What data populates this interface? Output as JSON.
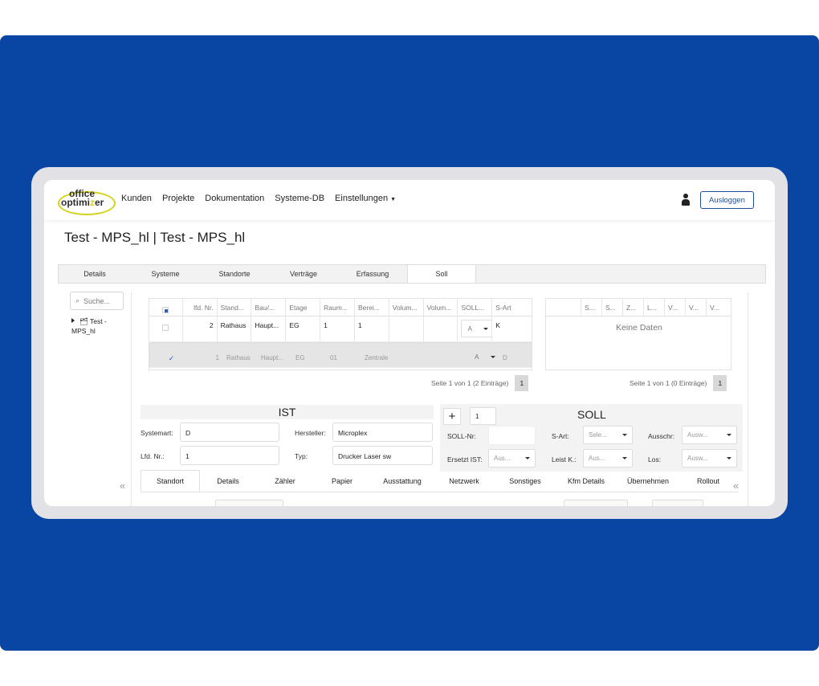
{
  "nav": {
    "logo_line1": "office",
    "logo_line2": "optimi",
    "logo_line3": "er",
    "items": [
      "Kunden",
      "Projekte",
      "Dokumentation",
      "Systeme-DB",
      "Einstellungen"
    ],
    "logout_label": "Ausloggen"
  },
  "page": {
    "title": "Test - MPS_hl | Test - MPS_hl"
  },
  "tabs1": [
    "Details",
    "Systeme",
    "Standorte",
    "Verträge",
    "Erfassung",
    "Soll"
  ],
  "sidebar": {
    "search_placeholder": "Suche...",
    "tree_item": "Test -",
    "tree_item2": "MPS_hl"
  },
  "grid": {
    "headers": [
      "lfd. Nr.",
      "Stand...",
      "Bau/...",
      "Etage",
      "Raum...",
      "Berei...",
      "Volum...",
      "Volum...",
      "SOLL...",
      "S-Art"
    ],
    "rows": [
      {
        "nr": "2",
        "stand": "Rathaus",
        "bau": "Haupt...",
        "etage": "EG",
        "raum": "1",
        "berei": "1",
        "dd": "A",
        "sart": "K"
      },
      {
        "nr": "1",
        "stand": "Rathaus",
        "bau": "Haupt...",
        "etage": "EG",
        "raum": "01",
        "berei": "Zentrale",
        "dd": "A",
        "sart": "D"
      }
    ],
    "pager_text": "Seite 1 von 1 (2 Einträge)",
    "page": "1"
  },
  "grid2": {
    "headers": [
      "S...",
      "S...",
      "Z...",
      "L...",
      "V...",
      "V...",
      "V..."
    ],
    "empty": "Keine Daten",
    "pager_text": "Seite 1 von 1 (0 Einträge)",
    "page": "1"
  },
  "ist": {
    "title": "IST",
    "systemart_label": "Systemart:",
    "systemart_value": "D",
    "hersteller_label": "Hersteller:",
    "hersteller_value": "Microplex",
    "lfd_label": "Lfd. Nr.:",
    "lfd_value": "1",
    "typ_label": "Typ:",
    "typ_value": "Drucker Laser sw"
  },
  "soll": {
    "title": "SOLL",
    "plus": "+",
    "number": "1",
    "sollnr_label": "SOLL-Nr:",
    "sart_label": "S-Art:",
    "sart_value": "Sele...",
    "ausschr_label": "Ausschr:",
    "ausschr_value": "Ausw...",
    "ersetzt_label": "Ersetzt IST:",
    "ersetzt_value": "Aus...",
    "leistk_label": "Leist K.:",
    "leistk_value": "Aus...",
    "los_label": "Los:",
    "los_value": "Ausw..."
  },
  "tabs2": [
    "Standort",
    "Details",
    "Zähler",
    "Papier",
    "Ausstattung",
    "Netzwerk",
    "Sonstiges",
    "Kfm Details",
    "Übernehmen",
    "Rollout"
  ],
  "colors": {
    "brand_blue": "#0946a3",
    "logo_yellow": "#d4d21a"
  }
}
